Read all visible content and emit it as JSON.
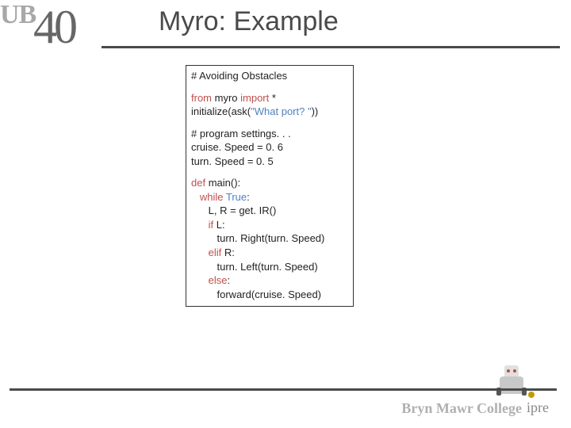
{
  "header": {
    "logo_text": "UB",
    "logo_number": "40",
    "title": "Myro: Example"
  },
  "code": {
    "comment_title": "# Avoiding Obstacles",
    "kw_from": "from",
    "mod": " myro ",
    "kw_import": "import",
    "star": " *",
    "init_pre": "initialize(ask(",
    "init_str": "\"What port? \"",
    "init_post": "))",
    "comment_settings": "# program settings. . .",
    "line_cruise": "cruise. Speed = 0. 6",
    "line_turn": "turn. Speed = 0. 5",
    "kw_def": "def",
    "main_sig": " main():",
    "kw_while": "while",
    "kw_true": "True",
    "colon": ":",
    "line_getir": "L, R = get. IR()",
    "kw_if": "if",
    "cond_l": " L:",
    "line_right": "turn. Right(turn. Speed)",
    "kw_elif": "elif",
    "cond_r": " R:",
    "line_left": "turn. Left(turn. Speed)",
    "kw_else": "else",
    "line_forward": "forward(cruise. Speed)"
  },
  "footer": {
    "text": "Bryn Mawr College",
    "ipre": "ipre"
  }
}
